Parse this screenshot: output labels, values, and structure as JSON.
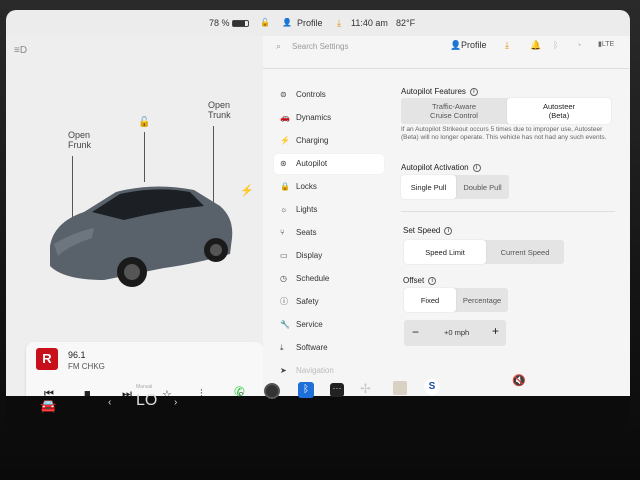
{
  "status_bar": {
    "battery_percent": "78 %",
    "profile_label": "Profile",
    "time": "11:40 am",
    "temperature": "82°F"
  },
  "car_view": {
    "open_frunk": "Open\nFrunk",
    "open_trunk": "Open\nTrunk"
  },
  "media": {
    "station": "96.1",
    "sub": "FM CHKG",
    "logo_letter": "R"
  },
  "settings": {
    "search_placeholder": "Search Settings",
    "profile_label": "Profile",
    "nav_items": [
      {
        "label": "Controls",
        "icon": "toggle-icon"
      },
      {
        "label": "Dynamics",
        "icon": "car-icon"
      },
      {
        "label": "Charging",
        "icon": "bolt-icon"
      },
      {
        "label": "Autopilot",
        "icon": "steering-wheel-icon"
      },
      {
        "label": "Locks",
        "icon": "lock-icon"
      },
      {
        "label": "Lights",
        "icon": "light-icon"
      },
      {
        "label": "Seats",
        "icon": "seat-icon"
      },
      {
        "label": "Display",
        "icon": "display-icon"
      },
      {
        "label": "Schedule",
        "icon": "clock-icon"
      },
      {
        "label": "Safety",
        "icon": "safety-icon"
      },
      {
        "label": "Service",
        "icon": "wrench-icon"
      },
      {
        "label": "Software",
        "icon": "download-icon"
      },
      {
        "label": "Navigation",
        "icon": "nav-icon"
      }
    ],
    "autopilot_features": {
      "title": "Autopilot Features",
      "option_a": "Traffic-Aware\nCruise Control",
      "option_b": "Autosteer\n(Beta)",
      "note": "If an Autopilot Strikeout occurs 5 times due to improper use, Autosteer (Beta) will no longer operate. This vehicle has not had any such events."
    },
    "autopilot_activation": {
      "title": "Autopilot Activation",
      "option_a": "Single Pull",
      "option_b": "Double Pull"
    },
    "set_speed": {
      "title": "Set Speed",
      "option_a": "Speed Limit",
      "option_b": "Current Speed"
    },
    "offset": {
      "title": "Offset",
      "option_a": "Fixed",
      "option_b": "Percentage",
      "minus": "−",
      "value": "+0 mph",
      "plus": "+"
    }
  },
  "taskbar": {
    "climate_label": "Manual",
    "temp": "LO",
    "volume_icon": "mute-icon"
  }
}
